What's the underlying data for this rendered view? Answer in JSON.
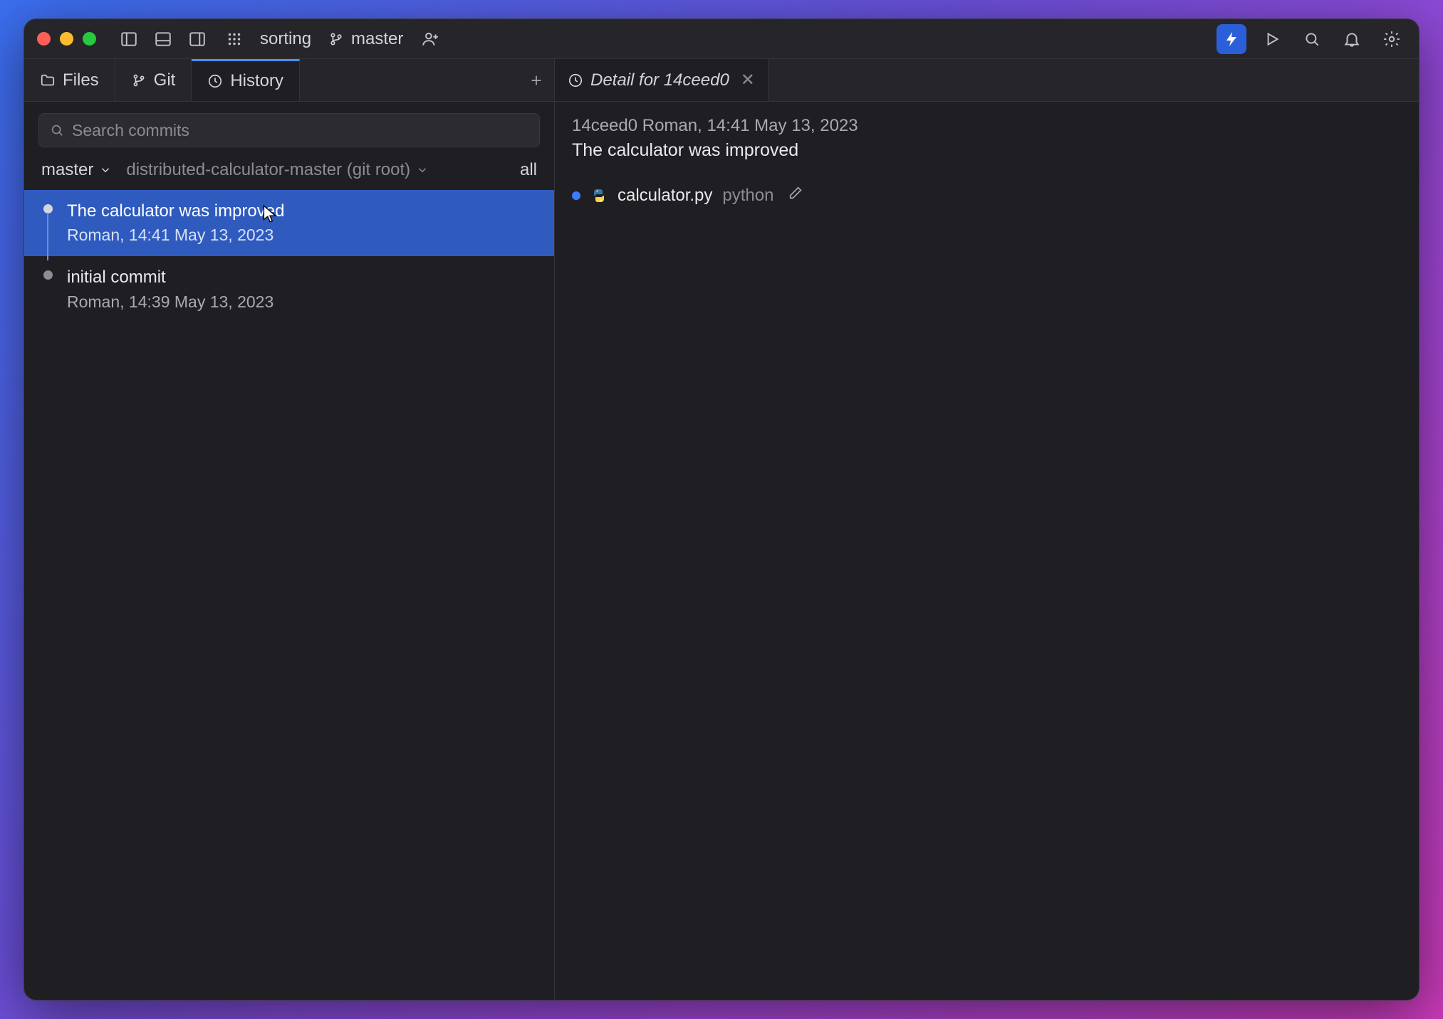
{
  "titlebar": {
    "project_name": "sorting",
    "branch_label": "master"
  },
  "left_tabs": {
    "files": "Files",
    "git": "Git",
    "history": "History"
  },
  "search": {
    "placeholder": "Search commits"
  },
  "filters": {
    "branch": "master",
    "root": "distributed-calculator-master (git root)",
    "all": "all"
  },
  "commits": [
    {
      "title": "The calculator was improved",
      "meta": "Roman, 14:41 May 13, 2023",
      "selected": true
    },
    {
      "title": "initial commit",
      "meta": "Roman, 14:39 May 13, 2023",
      "selected": false
    }
  ],
  "detail": {
    "tab_title": "Detail for 14ceed0",
    "header_line": "14ceed0 Roman, 14:41 May 13, 2023",
    "message": "The calculator was improved",
    "file": {
      "name": "calculator.py",
      "dir": "python"
    }
  }
}
